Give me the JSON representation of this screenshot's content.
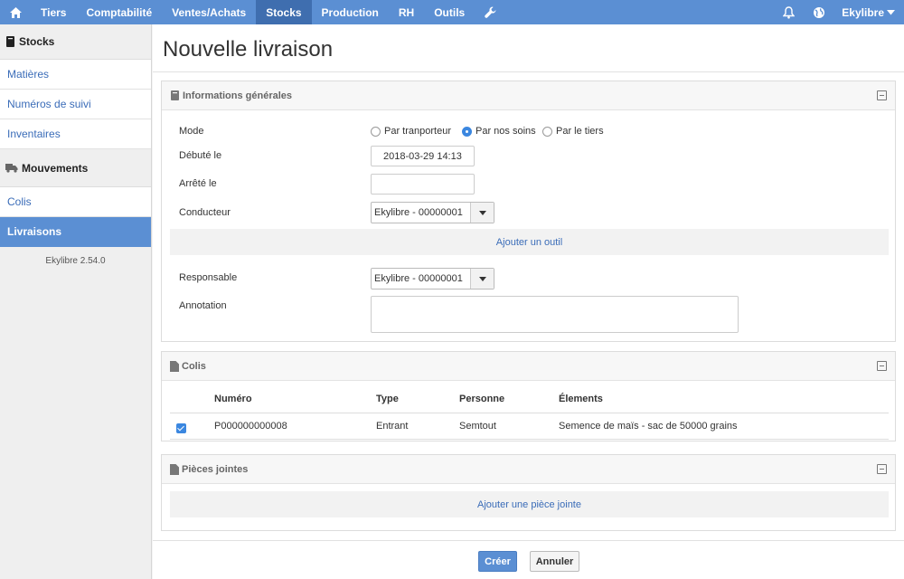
{
  "nav": {
    "items": [
      "Tiers",
      "Comptabilité",
      "Ventes/Achats",
      "Stocks",
      "Production",
      "RH",
      "Outils"
    ],
    "active": "Stocks",
    "user": "Ekylibre",
    "icons": [
      "home-icon",
      "wrench-icon",
      "bell-icon",
      "globe-icon",
      "caret-down-icon"
    ],
    "accent": "#5b8fd3",
    "active_color": "#3f6eaf"
  },
  "sidebar": {
    "section1": "Stocks",
    "section1_items": [
      "Matières",
      "Numéros de suivi",
      "Inventaires"
    ],
    "section2": "Mouvements",
    "section2_items": [
      "Colis",
      "Livraisons"
    ],
    "active": "Livraisons",
    "version": "Ekylibre 2.54.0"
  },
  "page": {
    "title": "Nouvelle livraison"
  },
  "general": {
    "title": "Informations générales",
    "mode_label": "Mode",
    "mode_options": [
      "Par tranporteur",
      "Par nos soins",
      "Par le tiers"
    ],
    "mode_selected": "Par nos soins",
    "started_label": "Débuté le",
    "started_value": "2018-03-29 14:13",
    "stopped_label": "Arrêté le",
    "stopped_value": "",
    "driver_label": "Conducteur",
    "driver_value": "Ekylibre - 00000001",
    "add_tool": "Ajouter un outil",
    "responsible_label": "Responsable",
    "responsible_value": "Ekylibre - 00000001",
    "annotation_label": "Annotation",
    "annotation_value": ""
  },
  "parcels": {
    "title": "Colis",
    "columns": [
      "Numéro",
      "Type",
      "Personne",
      "Élements"
    ],
    "rows": [
      {
        "checked": true,
        "number": "P000000000008",
        "type": "Entrant",
        "person": "Semtout",
        "elements": "Semence de maïs - sac de 50000 grains"
      }
    ]
  },
  "attachments": {
    "title": "Pièces jointes",
    "add": "Ajouter une pièce jointe"
  },
  "actions": {
    "create": "Créer",
    "cancel": "Annuler"
  }
}
